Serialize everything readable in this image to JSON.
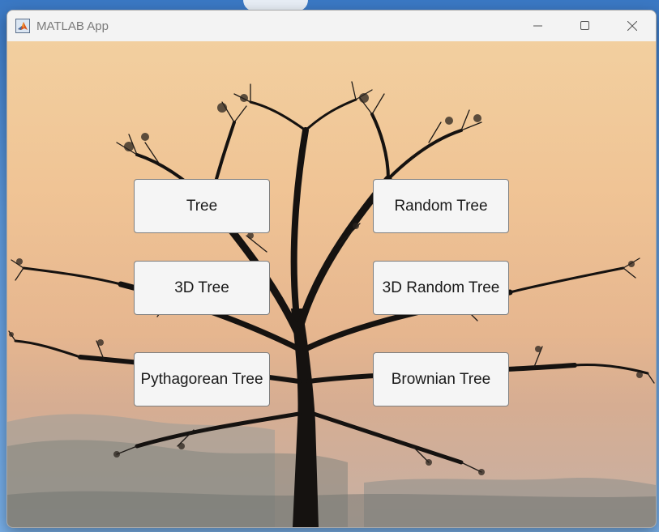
{
  "window": {
    "title": "MATLAB App",
    "controls": {
      "minimize_icon": "minimize-icon",
      "maximize_icon": "maximize-icon",
      "close_icon": "close-icon"
    }
  },
  "buttons": {
    "tree": "Tree",
    "random_tree": "Random Tree",
    "tree_3d": "3D Tree",
    "random_tree_3d": "3D Random Tree",
    "pythagorean_tree": "Pythagorean Tree",
    "brownian_tree": "Brownian Tree"
  },
  "colors": {
    "button_bg": "#f5f5f5",
    "button_border": "#7f7f7f",
    "sky_top": "#f2cf9f",
    "sky_bottom": "#c6b0a4",
    "tree_silhouette": "#151210"
  }
}
